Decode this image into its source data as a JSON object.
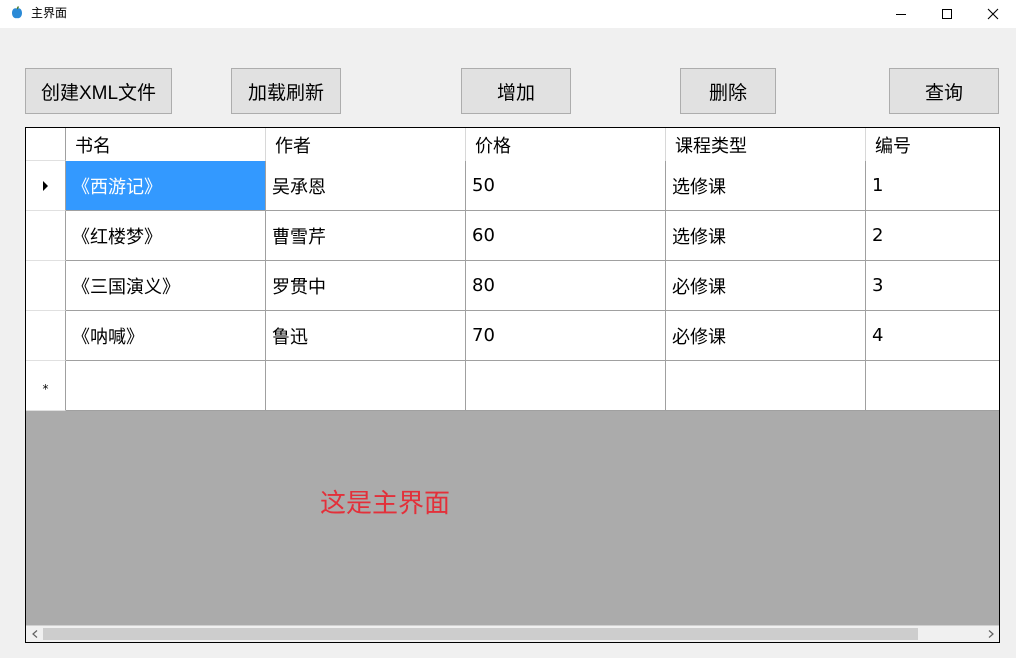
{
  "window": {
    "title": "主界面"
  },
  "toolbar": {
    "buttons": [
      {
        "label": "创建XML文件"
      },
      {
        "label": "加载刷新"
      },
      {
        "label": "增加"
      },
      {
        "label": "删除"
      },
      {
        "label": "查询"
      }
    ]
  },
  "grid": {
    "columns": [
      "书名",
      "作者",
      "价格",
      "课程类型",
      "编号"
    ],
    "rows": [
      [
        "《西游记》",
        "吴承恩",
        "50",
        "选修课",
        "1"
      ],
      [
        "《红楼梦》",
        "曹雪芹",
        "60",
        "选修课",
        "2"
      ],
      [
        "《三国演义》",
        "罗贯中",
        "80",
        "必修课",
        "3"
      ],
      [
        "《呐喊》",
        "鲁迅",
        "70",
        "必修课",
        "4"
      ]
    ],
    "new_row_marker": "*",
    "selected_cell_color": "#3399ff"
  },
  "main": {
    "label": "这是主界面",
    "label_color": "#e3303a"
  }
}
